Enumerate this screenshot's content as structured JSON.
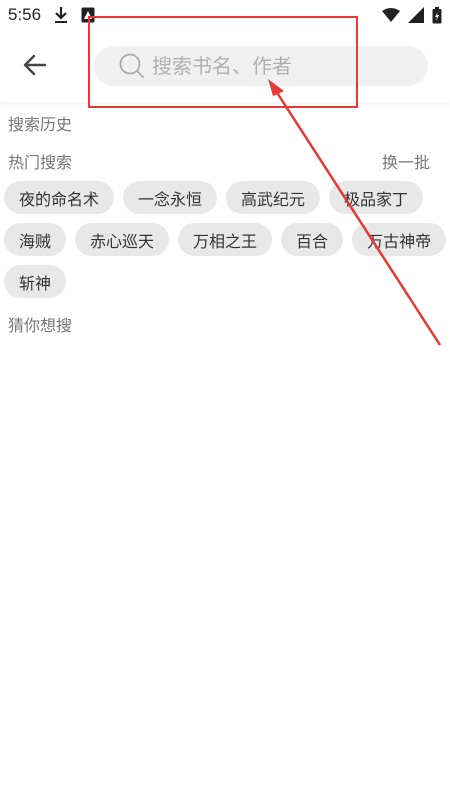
{
  "status_bar": {
    "time": "5:56",
    "left_icons": [
      "download-icon",
      "notification-icon"
    ],
    "right_icons": [
      "wifi-icon",
      "signal-icon",
      "battery-icon"
    ]
  },
  "header": {
    "back_icon": "arrow-left-icon",
    "search": {
      "placeholder": "搜索书名、作者",
      "value": ""
    }
  },
  "sections": {
    "history": {
      "title": "搜索历史"
    },
    "hot": {
      "title": "热门搜索",
      "refresh_label": "换一批",
      "tags": [
        "夜的命名术",
        "一念永恒",
        "高武纪元",
        "极品家丁",
        "海贼",
        "赤心巡天",
        "万相之王",
        "百合",
        "万古神帝",
        "斩神"
      ]
    },
    "guess": {
      "title": "猜你想搜"
    }
  },
  "colors": {
    "annotation": "#e53935",
    "tag_bg": "#e8e8e8",
    "search_bg": "#f0f0f0"
  }
}
